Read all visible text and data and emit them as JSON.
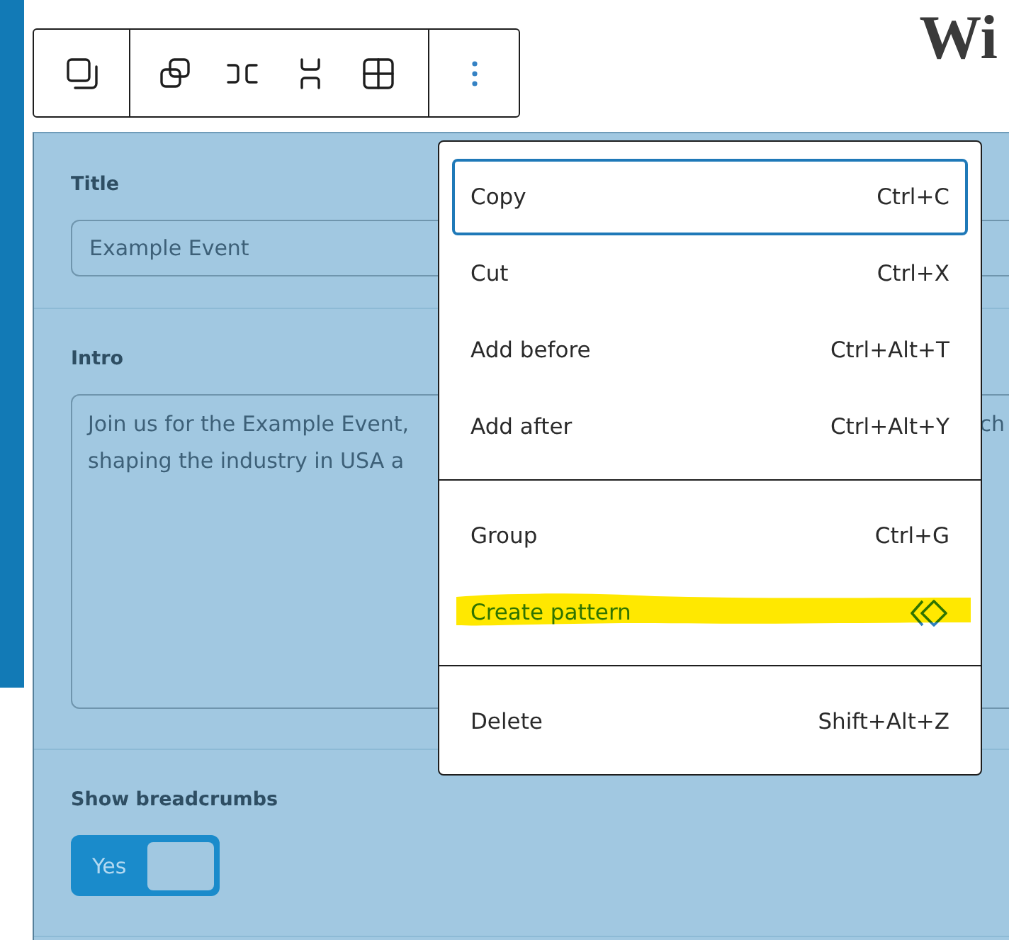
{
  "heading": "Wi",
  "toolbar": {
    "options_expanded": true
  },
  "fields": [
    {
      "kind": "text",
      "label": "Title",
      "value": "Example Event"
    },
    {
      "kind": "textarea",
      "label": "Intro",
      "visible_lines": [
        "Join us for the Example Event,",
        "shaping the industry in USA a"
      ],
      "visible_right": "ch"
    },
    {
      "kind": "toggle",
      "label": "Show breadcrumbs",
      "on": true,
      "text": "Yes"
    }
  ],
  "menu": {
    "groups": [
      {
        "items": [
          {
            "kind": "shortcut",
            "label": "Copy",
            "shortcut": "Ctrl+C",
            "focused": true,
            "highlighted": false
          },
          {
            "kind": "shortcut",
            "label": "Cut",
            "shortcut": "Ctrl+X",
            "focused": false,
            "highlighted": false
          },
          {
            "kind": "shortcut",
            "label": "Add before",
            "shortcut": "Ctrl+Alt+T",
            "focused": false,
            "highlighted": false
          },
          {
            "kind": "shortcut",
            "label": "Add after",
            "shortcut": "Ctrl+Alt+Y",
            "focused": false,
            "highlighted": false
          }
        ]
      },
      {
        "items": [
          {
            "kind": "shortcut",
            "label": "Group",
            "shortcut": "Ctrl+G",
            "focused": false,
            "highlighted": false
          },
          {
            "kind": "icon",
            "label": "Create pattern",
            "focused": false,
            "highlighted": true
          }
        ]
      },
      {
        "items": [
          {
            "kind": "shortcut",
            "label": "Delete",
            "shortcut": "Shift+Alt+Z",
            "focused": false,
            "highlighted": false
          }
        ]
      }
    ]
  }
}
